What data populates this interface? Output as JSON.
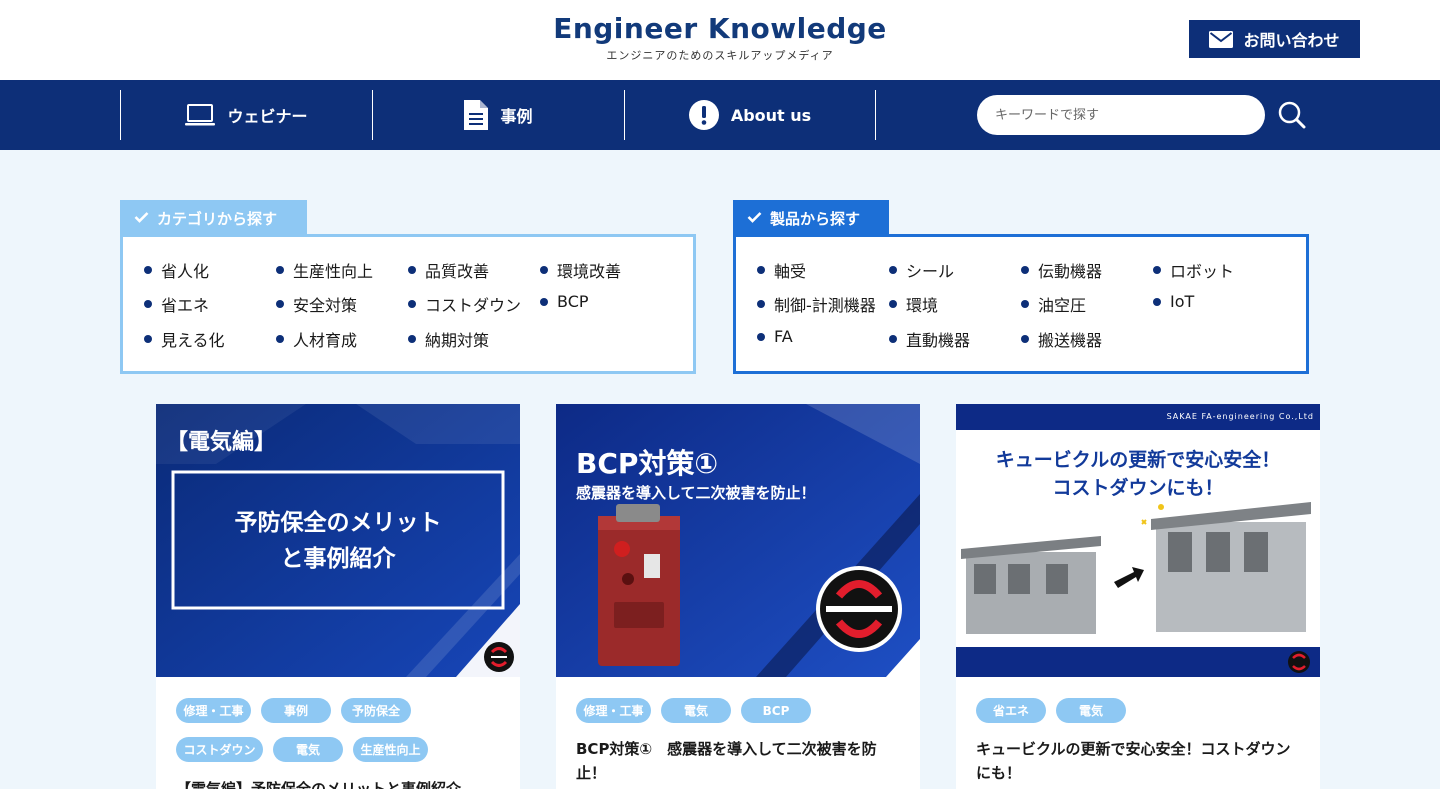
{
  "header": {
    "logo_title": "Engineer Knowledge",
    "logo_subtitle": "エンジニアのためのスキルアップメディア",
    "contact_label": "お問い合わせ"
  },
  "nav": {
    "items": [
      {
        "label": "ウェビナー",
        "icon": "laptop-icon"
      },
      {
        "label": "事例",
        "icon": "document-icon"
      },
      {
        "label": "About us",
        "icon": "exclamation-icon"
      }
    ],
    "search_placeholder": "キーワードで探す"
  },
  "category_panel": {
    "title": "カテゴリから探す",
    "items": [
      "省人化",
      "生産性向上",
      "品質改善",
      "環境改善",
      "省エネ",
      "安全対策",
      "コストダウン",
      "BCP",
      "見える化",
      "人材育成",
      "納期対策"
    ]
  },
  "product_panel": {
    "title": "製品から探す",
    "items": [
      "軸受",
      "シール",
      "伝動機器",
      "ロボット",
      "制御-計測機器",
      "環境",
      "油空圧",
      "IoT",
      "FA",
      "直動機器",
      "搬送機器"
    ]
  },
  "cards": [
    {
      "image_heading": "【電気編】",
      "image_text_1": "予防保全のメリット",
      "image_text_2": "と事例紹介",
      "tags": [
        "修理・工事",
        "事例",
        "予防保全",
        "コストダウン",
        "電気",
        "生産性向上"
      ],
      "title": "【電気編】予防保全のメリットと事例紹介"
    },
    {
      "image_heading": "BCP対策①",
      "image_text_1": "感震器を導入して二次被害を防止！",
      "tags": [
        "修理・工事",
        "電気",
        "BCP"
      ],
      "title": "BCP対策①　感震器を導入して二次被害を防止！"
    },
    {
      "image_company": "SAKAE FA-engineering Co.,Ltd",
      "image_text_1": "キュービクルの更新で安心安全！",
      "image_text_2": "コストダウンにも！",
      "tags": [
        "省エネ",
        "電気"
      ],
      "title": "キュービクルの更新で安心安全！コストダウンにも！"
    }
  ],
  "colors": {
    "primary": "#0d2f78",
    "category_tab": "#8ec8f3",
    "product_tab": "#1d6fd6",
    "tag": "#8ec8f3",
    "background": "#eef6fc"
  }
}
